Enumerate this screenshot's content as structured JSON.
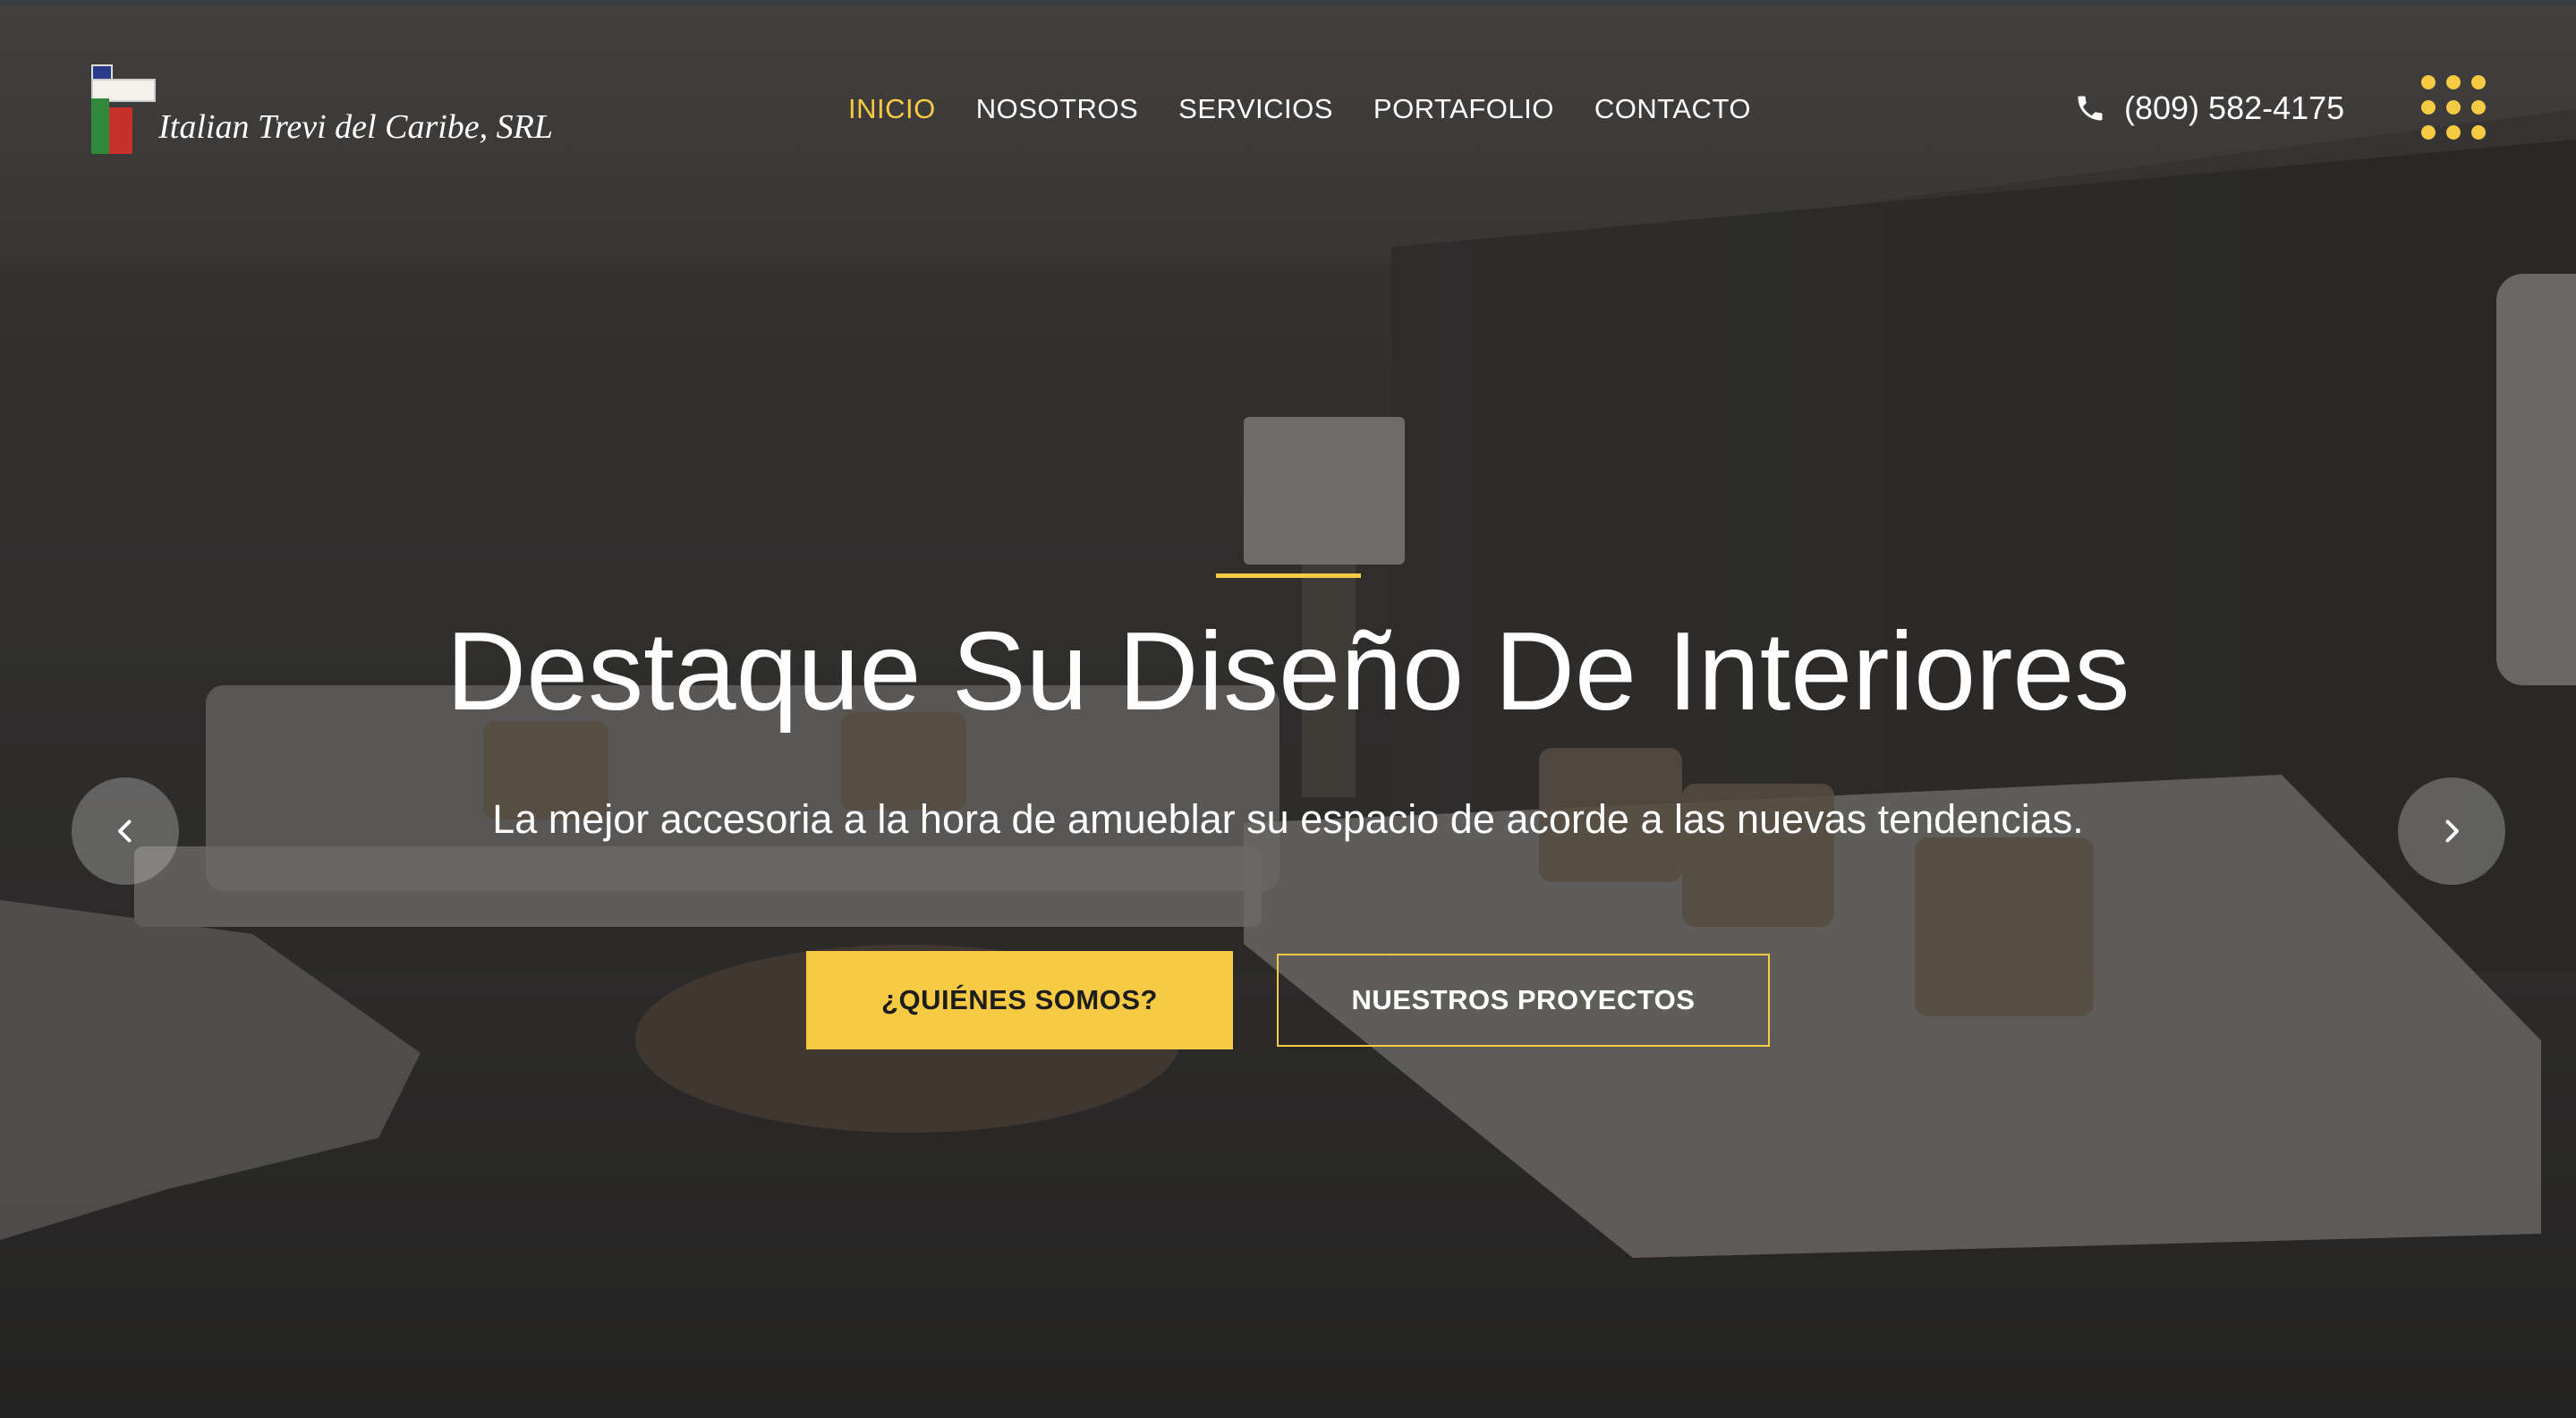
{
  "brand": {
    "name": "Italian Trevi del Caribe, SRL"
  },
  "nav": {
    "items": [
      {
        "label": "INICIO",
        "active": true
      },
      {
        "label": "NOSOTROS",
        "active": false
      },
      {
        "label": "SERVICIOS",
        "active": false
      },
      {
        "label": "PORTAFOLIO",
        "active": false
      },
      {
        "label": "CONTACTO",
        "active": false
      }
    ]
  },
  "header": {
    "phone": "(809) 582-4175",
    "phone_icon": "phone-icon",
    "menu_icon": "grid-dots-icon"
  },
  "hero": {
    "title": "Destaque Su Diseño De Interiores",
    "subtitle": "La mejor accesoria a la hora de amueblar su espacio de acorde a las nuevas tendencias.",
    "primary_button": "¿QUIÉNES SOMOS?",
    "secondary_button": "NUESTROS PROYECTOS",
    "prev_icon": "chevron-left-icon",
    "next_icon": "chevron-right-icon"
  },
  "colors": {
    "accent": "#f7ca44",
    "text": "#ffffff",
    "overlay": "#141414"
  }
}
